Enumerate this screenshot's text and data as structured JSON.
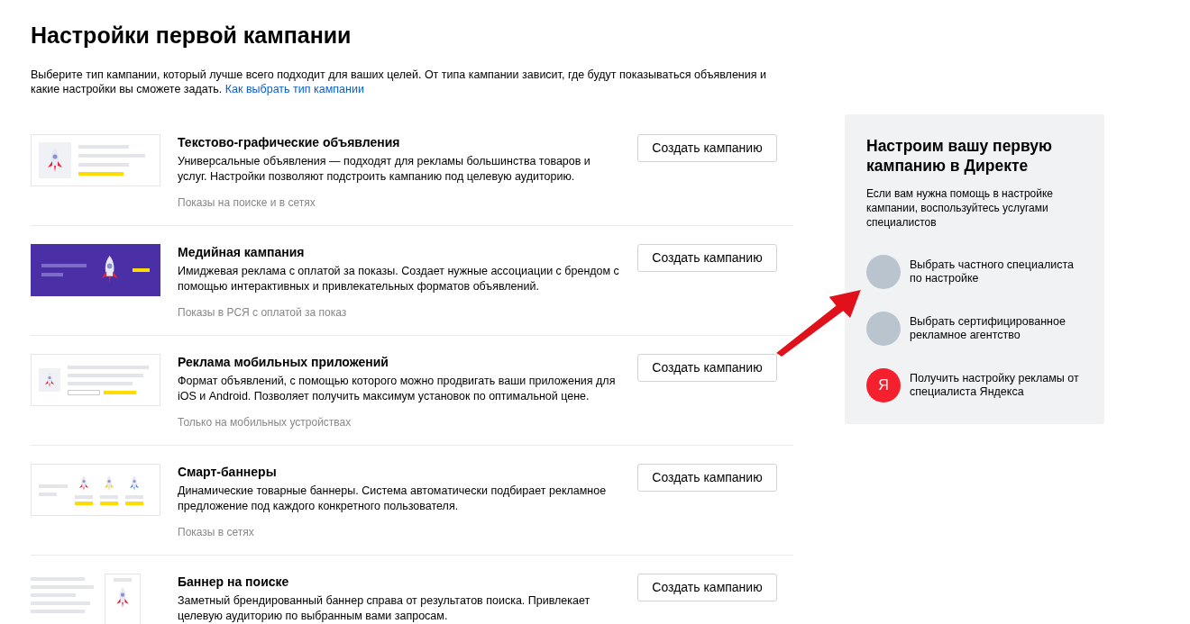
{
  "title": "Настройки первой кампании",
  "intro": {
    "text": "Выберите тип кампании, который лучше всего подходит для ваших целей. От типа кампании зависит, где будут показываться объявления и какие настройки вы сможете задать.",
    "link": "Как выбрать тип кампании"
  },
  "campaigns": [
    {
      "kind": "text",
      "name": "Текстово-графические объявления",
      "description": "Универсальные объявления — подходят для рекламы большинства товаров и услуг. Настройки позволяют подстроить кампанию под целевую аудиторию.",
      "placement": "Показы на поиске и в сетях",
      "button": "Создать кампанию"
    },
    {
      "kind": "media",
      "name": "Медийная кампания",
      "description": "Имиджевая реклама с оплатой за показы. Создает нужные ассоциации с брендом с помощью интерактивных и привлекательных форматов объявлений.",
      "placement": "Показы в РСЯ с оплатой за показ",
      "button": "Создать кампанию"
    },
    {
      "kind": "mobile",
      "name": "Реклама мобильных приложений",
      "description": "Формат объявлений, с помощью которого можно продвигать ваши приложения для iOS и Android. Позволяет получить максимум установок по оптимальной цене.",
      "placement": "Только на мобильных устройствах",
      "button": "Создать кампанию"
    },
    {
      "kind": "smart",
      "name": "Смарт-баннеры",
      "description": "Динамические товарные баннеры. Система автоматически подбирает рекламное предложение под каждого конкретного пользователя.",
      "placement": "Показы в сетях",
      "button": "Создать кампанию"
    },
    {
      "kind": "search",
      "name": "Баннер на поиске",
      "description": "Заметный брендированный баннер справа от результатов поиска. Привлекает целевую аудиторию по выбранным вами запросам.",
      "button": "Создать кампанию"
    }
  ],
  "help_panel": {
    "title": "Настроим вашу первую кампанию в Директе",
    "text": "Если вам нужна помощь в настройке кампании, воспользуйтесь услугами специалистов",
    "options": [
      {
        "kind": "photo",
        "label": "Выбрать частного специалиста по настройке"
      },
      {
        "kind": "photo",
        "label": "Выбрать сертифицированное рекламное агентство"
      },
      {
        "kind": "logo",
        "logo": "Я",
        "label": "Получить настройку рекламы от специалиста Яндекса"
      }
    ]
  }
}
